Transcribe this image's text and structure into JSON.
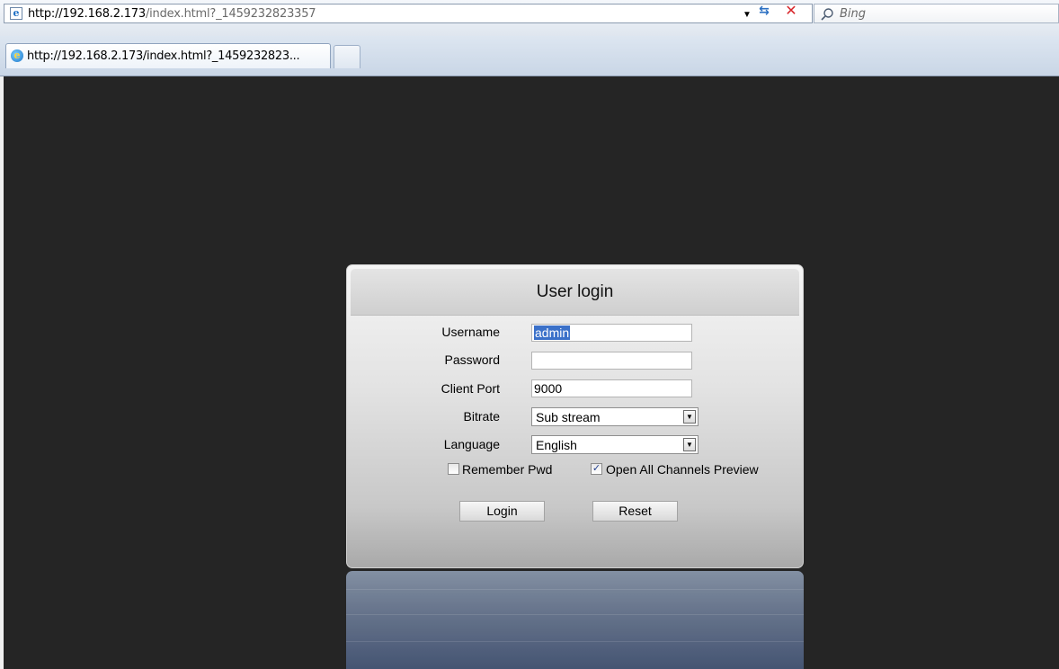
{
  "browser": {
    "url_host": "http://192.168.2.173",
    "url_path": "/index.html?_1459232823357",
    "search_placeholder": "Bing",
    "tab_title": "http://192.168.2.173/index.html?_1459232823..."
  },
  "login": {
    "title": "User login",
    "fields": {
      "username_label": "Username",
      "username_value": "admin",
      "password_label": "Password",
      "password_value": "",
      "client_port_label": "Client Port",
      "client_port_value": "9000",
      "bitrate_label": "Bitrate",
      "bitrate_value": "Sub stream",
      "language_label": "Language",
      "language_value": "English"
    },
    "options": {
      "remember_pwd_label": "Remember Pwd",
      "remember_pwd_checked": false,
      "open_all_channels_label": "Open All Channels Preview",
      "open_all_channels_checked": true
    },
    "buttons": {
      "login": "Login",
      "reset": "Reset"
    }
  },
  "colors": {
    "page_background": "#252525",
    "selection": "#3b71c9",
    "stop_icon": "#d8262b",
    "refresh_icon": "#2b6fc2"
  }
}
